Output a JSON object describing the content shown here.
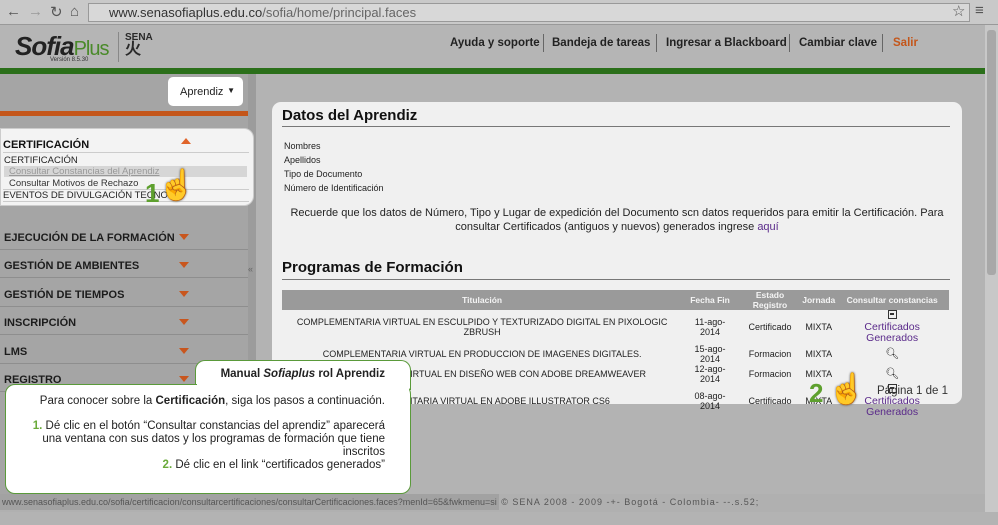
{
  "browser": {
    "url_domain": "www.senasofiaplus.edu.co",
    "url_path": "/sofia/home/principal.faces"
  },
  "header": {
    "logo_text": "Sofia",
    "logo_plus": "Plus",
    "version": "Versión 8.5.30",
    "sena_logo": "SENA",
    "links": [
      "Ayuda y soporte",
      "Bandeja de tareas",
      "Ingresar a Blackboard",
      "Cambiar clave",
      "Salir"
    ]
  },
  "colors": {
    "brand_green": "#2b6f1a",
    "accent_orange": "#c4561a",
    "callout_green": "#6aaa3a"
  },
  "role_select": {
    "value": "Aprendiz"
  },
  "sidebar": {
    "expanded": {
      "title": "CERTIFICACIÓN",
      "group": "CERTIFICACIÓN",
      "items": [
        "Consultar Constancias del Aprendiz",
        "Consultar Motivos de Rechazo"
      ],
      "next_group": "EVENTOS DE DIVULGACIÓN TECNOL..."
    },
    "items": [
      "EJECUCIÓN DE LA FORMACIÓN",
      "GESTIÓN DE AMBIENTES",
      "GESTIÓN DE TIEMPOS",
      "INSCRIPCIÓN",
      "LMS",
      "REGISTRO"
    ]
  },
  "main": {
    "datos_title": "Datos del Aprendiz",
    "fields": [
      "Nombres",
      "Apellidos",
      "Tipo de Documento",
      "Número de Identificación"
    ],
    "notice": "Recuerde que los datos de Número, Tipo y Lugar de expedición del Documento scn datos requeridos para emitir la Certificación. Para consultar Certificados (antiguos y nuevos) generados ingrese ",
    "notice_link": "aquí",
    "programas_title": "Programas de Formación",
    "columns": [
      "Titulación",
      "Fecha Fin",
      "Estado Registro",
      "Jornada",
      "Consultar constancias"
    ],
    "rows": [
      {
        "titulacion": "COMPLEMENTARIA VIRTUAL EN ESCULPIDO Y TEXTURIZADO DIGITAL EN PIXOLOGIC ZBRUSH",
        "fecha": "11-ago-2014",
        "estado": "Certificado",
        "jornada": "MIXTA",
        "accion": "Certificados Generados",
        "icon": "document-icon"
      },
      {
        "titulacion": "COMPLEMENTARIA VIRTUAL EN PRODUCCION DE IMAGENES DIGITALES.",
        "fecha": "15-ago-2014",
        "estado": "Formacion",
        "jornada": "MIXTA",
        "accion": "",
        "icon": "search-icon"
      },
      {
        "titulacion": "COMPLEMENTARIA VIRTUAL EN DISEÑO WEB CON ADOBE DREAMWEAVER",
        "fecha": "12-ago-2014",
        "estado": "Formacion",
        "jornada": "MIXTA",
        "accion": "",
        "icon": "search-icon"
      },
      {
        "titulacion": "COMPLEMENTARIA VIRTUAL EN ADOBE ILLUSTRATOR CS6",
        "fecha": "08-ago-2014",
        "estado": "Certificado",
        "jornada": "MIXTA",
        "accion": "Certificados Generados",
        "icon": "document-icon"
      }
    ],
    "pagination": "Página 1 de 1"
  },
  "callout": {
    "title_a": "Manual ",
    "title_b": "Sofiaplus",
    "title_c": " rol Aprendiz",
    "intro_a": "Para conocer sobre la ",
    "intro_b": "Certificación",
    "intro_c": ", siga los pasos a continuación.",
    "step1_num": "1.",
    "step1": " Dé clic en el botón “Consultar constancias del aprendiz” aparecerá una ventana con sus datos y los programas de formación que tiene inscritos",
    "step2_num": "2.",
    "step2": " Dé clic en el link “certificados generados”"
  },
  "steps": [
    "1",
    "2"
  ],
  "status": {
    "url": "www.senasofiaplus.edu.co/sofia/certificacion/consultarcertificaciones/consultarCertificaciones.faces?menId=65&fwkmenu=si",
    "footer": "© SENA 2008 - 2009 -+- Bogotá - Colombia- --.s.52;"
  }
}
